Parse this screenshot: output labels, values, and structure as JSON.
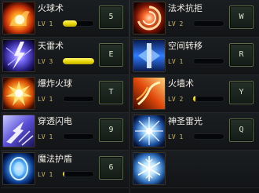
{
  "skills_left": [
    {
      "name": "火球术",
      "level": "LV 1",
      "progress": 0.45,
      "hotkey": "5",
      "icon": "fireball-icon"
    },
    {
      "name": "天雷术",
      "level": "LV 3",
      "progress": 1.0,
      "hotkey": "E",
      "icon": "thunder-icon"
    },
    {
      "name": "爆炸火球",
      "level": "LV 1",
      "progress": 0.0,
      "hotkey": "T",
      "icon": "explosion-icon"
    },
    {
      "name": "穿透闪电",
      "level": "LV 1",
      "progress": 0.0,
      "hotkey": "9",
      "icon": "piercing-lightning-icon"
    },
    {
      "name": "魔法护盾",
      "level": "LV 1",
      "progress": 0.05,
      "hotkey": "6",
      "icon": "magic-shield-icon"
    }
  ],
  "skills_right": [
    {
      "name": "法术抗拒",
      "level": "LV 2",
      "progress": 0.0,
      "hotkey": "W",
      "icon": "spell-resist-icon"
    },
    {
      "name": "空间转移",
      "level": "LV 1",
      "progress": 0.0,
      "hotkey": "R",
      "icon": "teleport-icon"
    },
    {
      "name": "火墙术",
      "level": "LV 2",
      "progress": 0.08,
      "hotkey": "Y",
      "icon": "fire-wall-icon"
    },
    {
      "name": "神圣雷光",
      "level": "LV 1",
      "progress": 0.0,
      "hotkey": "Q",
      "icon": "holy-lightning-icon"
    },
    {
      "name": "",
      "level": "",
      "progress": 0.0,
      "hotkey": "",
      "icon": "ice-icon"
    }
  ]
}
